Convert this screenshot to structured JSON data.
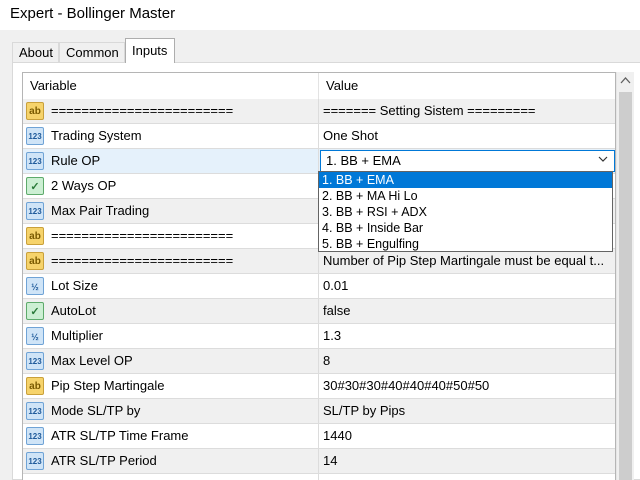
{
  "window": {
    "title": "Expert - Bollinger Master"
  },
  "tabs": [
    {
      "label": "About"
    },
    {
      "label": "Common"
    },
    {
      "label": "Inputs"
    }
  ],
  "table": {
    "headers": {
      "variable": "Variable",
      "value": "Value"
    },
    "rows": [
      {
        "icon": "ab",
        "name": "========================",
        "value": "======= Setting Sistem ========="
      },
      {
        "icon": "123",
        "name": "Trading System",
        "value": "One Shot"
      },
      {
        "icon": "123",
        "name": "Rule OP",
        "value": "1. BB + EMA"
      },
      {
        "icon": "bool",
        "name": "2 Ways OP",
        "value": ""
      },
      {
        "icon": "123",
        "name": "Max Pair Trading",
        "value": ""
      },
      {
        "icon": "ab",
        "name": "========================",
        "value": ""
      },
      {
        "icon": "ab",
        "name": "========================",
        "value": "Number of Pip Step Martingale must be equal t..."
      },
      {
        "icon": "frac",
        "name": "Lot Size",
        "value": "0.01"
      },
      {
        "icon": "bool",
        "name": "AutoLot",
        "value": "false"
      },
      {
        "icon": "frac",
        "name": "Multiplier",
        "value": "1.3"
      },
      {
        "icon": "123",
        "name": "Max Level OP",
        "value": "8"
      },
      {
        "icon": "ab",
        "name": "Pip Step Martingale",
        "value": "30#30#30#40#40#40#50#50"
      },
      {
        "icon": "123",
        "name": "Mode SL/TP by",
        "value": "SL/TP by Pips"
      },
      {
        "icon": "123",
        "name": "ATR SL/TP Time Frame",
        "value": "1440"
      },
      {
        "icon": "123",
        "name": "ATR SL/TP Period",
        "value": "14"
      }
    ]
  },
  "icons": {
    "ab": "ab",
    "123": "123",
    "frac": "½",
    "bool": "✓"
  },
  "dropdown": {
    "selected_index": 0,
    "options": [
      "1. BB + EMA",
      "2. BB + MA Hi Lo",
      "3. BB + RSI + ADX",
      "4. BB + Inside Bar",
      "5. BB + Engulfing"
    ]
  },
  "colors": {
    "accent": "#0078d7",
    "selected_row": "#e5f1fb"
  }
}
